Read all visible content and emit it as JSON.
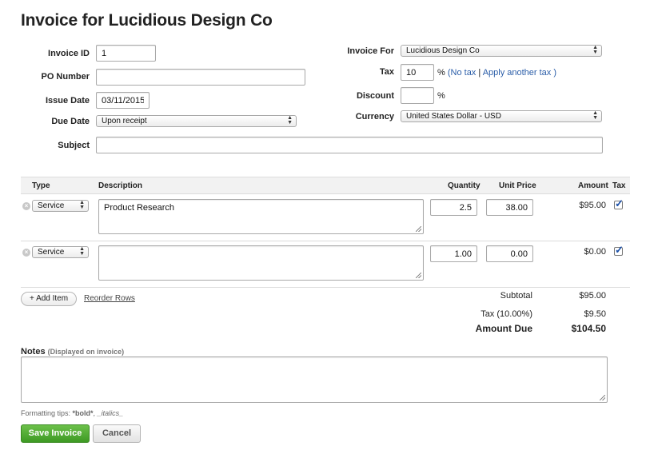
{
  "page": {
    "title": "Invoice for Lucidious Design Co"
  },
  "form": {
    "invoice_id": {
      "label": "Invoice ID",
      "value": "1"
    },
    "po_number": {
      "label": "PO Number",
      "value": ""
    },
    "issue_date": {
      "label": "Issue Date",
      "value": "03/11/2015"
    },
    "due_date": {
      "label": "Due Date",
      "value": "Upon receipt"
    },
    "subject": {
      "label": "Subject",
      "value": ""
    },
    "invoice_for": {
      "label": "Invoice For",
      "value": "Lucidious Design Co"
    },
    "tax": {
      "label": "Tax",
      "value": "10",
      "pct": "%",
      "open": "(",
      "no_tax": "No tax",
      "sep": "|",
      "apply_another": "Apply another tax",
      "close": ")"
    },
    "discount": {
      "label": "Discount",
      "value": "",
      "pct": "%"
    },
    "currency": {
      "label": "Currency",
      "value": "United States Dollar - USD"
    }
  },
  "table": {
    "headers": {
      "type": "Type",
      "description": "Description",
      "quantity": "Quantity",
      "unit_price": "Unit Price",
      "amount": "Amount",
      "tax": "Tax"
    },
    "rows": [
      {
        "type": "Service",
        "description": "Product Research",
        "quantity": "2.5",
        "unit_price": "38.00",
        "amount": "$95.00",
        "taxed": true
      },
      {
        "type": "Service",
        "description": "",
        "quantity": "1.00",
        "unit_price": "0.00",
        "amount": "$0.00",
        "taxed": true
      }
    ],
    "add_item": "+ Add Item",
    "reorder_rows": "Reorder Rows"
  },
  "totals": {
    "subtotal_label": "Subtotal",
    "subtotal": "$95.00",
    "tax_label": "Tax (10.00%)",
    "tax": "$9.50",
    "amount_due_label": "Amount Due",
    "amount_due": "$104.50"
  },
  "notes": {
    "label": "Notes",
    "hint": "(Displayed on invoice)",
    "value": "",
    "tips_prefix": "Formatting tips:",
    "tips_bold": "*bold*",
    "tips_sep": ",",
    "tips_italics": "_italics_"
  },
  "actions": {
    "save": "Save Invoice",
    "cancel": "Cancel"
  },
  "colors": {
    "link": "#2a5da8",
    "save_green": "#4caf32",
    "tick_blue": "#1a4fa8"
  }
}
